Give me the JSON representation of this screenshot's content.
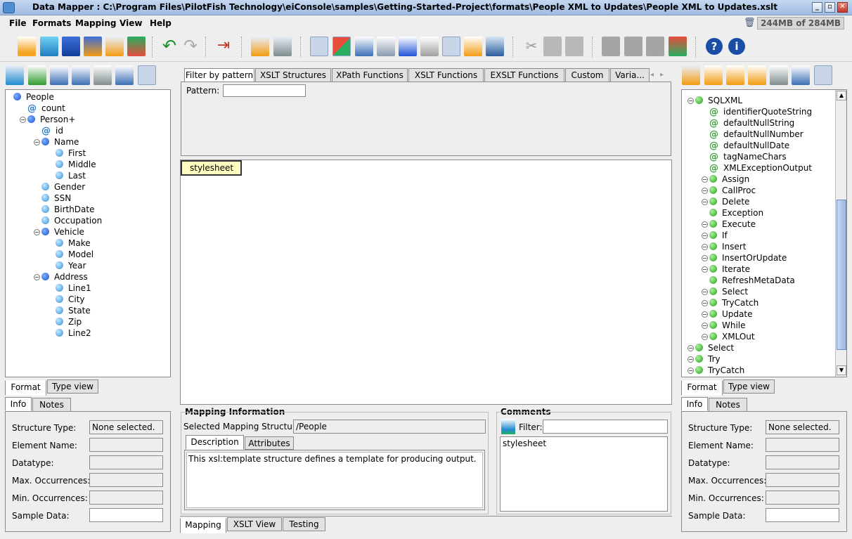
{
  "window": {
    "title": "Data Mapper : C:\\Program Files\\PilotFish Technology\\eiConsole\\samples\\Getting-Started-Project\\formats\\People XML to Updates\\People XML to Updates.xslt"
  },
  "menu": [
    "File",
    "Formats",
    "Mapping",
    "View",
    "Help"
  ],
  "memory": "244MB of 284MB",
  "left_tree": [
    {
      "label": "People",
      "kind": "element",
      "indent": 0,
      "exp": false
    },
    {
      "label": "count",
      "kind": "attr",
      "indent": 1,
      "exp": false
    },
    {
      "label": "Person+",
      "kind": "element",
      "indent": 1,
      "exp": true
    },
    {
      "label": "id",
      "kind": "attr",
      "indent": 2,
      "exp": false
    },
    {
      "label": "Name",
      "kind": "element",
      "indent": 2,
      "exp": true
    },
    {
      "label": "First",
      "kind": "leaf",
      "indent": 3,
      "exp": false
    },
    {
      "label": "Middle",
      "kind": "leaf",
      "indent": 3,
      "exp": false
    },
    {
      "label": "Last",
      "kind": "leaf",
      "indent": 3,
      "exp": false
    },
    {
      "label": "Gender",
      "kind": "leaf",
      "indent": 2,
      "exp": false
    },
    {
      "label": "SSN",
      "kind": "leaf",
      "indent": 2,
      "exp": false
    },
    {
      "label": "BirthDate",
      "kind": "leaf",
      "indent": 2,
      "exp": false
    },
    {
      "label": "Occupation",
      "kind": "leaf",
      "indent": 2,
      "exp": false
    },
    {
      "label": "Vehicle",
      "kind": "element",
      "indent": 2,
      "exp": true
    },
    {
      "label": "Make",
      "kind": "leaf",
      "indent": 3,
      "exp": false
    },
    {
      "label": "Model",
      "kind": "leaf",
      "indent": 3,
      "exp": false
    },
    {
      "label": "Year",
      "kind": "leaf",
      "indent": 3,
      "exp": false
    },
    {
      "label": "Address",
      "kind": "element",
      "indent": 2,
      "exp": true
    },
    {
      "label": "Line1",
      "kind": "leaf",
      "indent": 3,
      "exp": false
    },
    {
      "label": "City",
      "kind": "leaf",
      "indent": 3,
      "exp": false
    },
    {
      "label": "State",
      "kind": "leaf",
      "indent": 3,
      "exp": false
    },
    {
      "label": "Zip",
      "kind": "leaf",
      "indent": 3,
      "exp": false
    },
    {
      "label": "Line2",
      "kind": "leaf",
      "indent": 3,
      "exp": false
    }
  ],
  "left_view_tabs": [
    "Format",
    "Type view"
  ],
  "left_info_tabs": [
    "Info",
    "Notes"
  ],
  "info_labels": [
    "Structure Type:",
    "Element Name:",
    "Datatype:",
    "Max. Occurrences:",
    "Min. Occurrences:",
    "Sample Data:"
  ],
  "left_info_values": [
    "None selected.",
    "",
    "",
    "",
    "",
    ""
  ],
  "center_tabs": [
    "Filter by pattern",
    "XSLT Structures",
    "XPath Functions",
    "XSLT Functions",
    "EXSLT Functions",
    "Custom",
    "Varia..."
  ],
  "pattern_label": "Pattern:",
  "pattern_value": "",
  "mapping_node": "stylesheet",
  "mapping_info": {
    "title": "Mapping Information",
    "selected_label": "Selected Mapping Structure:",
    "selected_value": "/People",
    "tabs": [
      "Description",
      "Attributes"
    ],
    "description": "This xsl:template structure defines a template for producing output."
  },
  "comments": {
    "title": "Comments",
    "filter_label": "Filter:",
    "filter_value": "",
    "text": "stylesheet"
  },
  "bottom_tabs": [
    "Mapping",
    "XSLT View",
    "Testing"
  ],
  "right_tree": [
    {
      "label": "SQLXML",
      "kind": "green",
      "indent": 0,
      "exp": true
    },
    {
      "label": "identifierQuoteString",
      "kind": "attrg",
      "indent": 1,
      "exp": false
    },
    {
      "label": "defaultNullString",
      "kind": "attrg",
      "indent": 1,
      "exp": false
    },
    {
      "label": "defaultNullNumber",
      "kind": "attrg",
      "indent": 1,
      "exp": false
    },
    {
      "label": "defaultNullDate",
      "kind": "attrg",
      "indent": 1,
      "exp": false
    },
    {
      "label": "tagNameChars",
      "kind": "attrg",
      "indent": 1,
      "exp": false
    },
    {
      "label": "XMLExceptionOutput",
      "kind": "attrg",
      "indent": 1,
      "exp": false
    },
    {
      "label": "Assign",
      "kind": "green",
      "indent": 1,
      "exp": true
    },
    {
      "label": "CallProc",
      "kind": "green",
      "indent": 1,
      "exp": true
    },
    {
      "label": "Delete",
      "kind": "green",
      "indent": 1,
      "exp": true
    },
    {
      "label": "Exception",
      "kind": "green",
      "indent": 1,
      "exp": false
    },
    {
      "label": "Execute",
      "kind": "green",
      "indent": 1,
      "exp": true
    },
    {
      "label": "If",
      "kind": "green",
      "indent": 1,
      "exp": true
    },
    {
      "label": "Insert",
      "kind": "green",
      "indent": 1,
      "exp": true
    },
    {
      "label": "InsertOrUpdate",
      "kind": "green",
      "indent": 1,
      "exp": true
    },
    {
      "label": "Iterate",
      "kind": "green",
      "indent": 1,
      "exp": true
    },
    {
      "label": "RefreshMetaData",
      "kind": "green",
      "indent": 1,
      "exp": false
    },
    {
      "label": "Select",
      "kind": "green",
      "indent": 1,
      "exp": true
    },
    {
      "label": "TryCatch",
      "kind": "green",
      "indent": 1,
      "exp": true
    },
    {
      "label": "Update",
      "kind": "green",
      "indent": 1,
      "exp": true
    },
    {
      "label": "While",
      "kind": "green",
      "indent": 1,
      "exp": true
    },
    {
      "label": "XMLOut",
      "kind": "green",
      "indent": 1,
      "exp": true
    },
    {
      "label": "Select",
      "kind": "green",
      "indent": 0,
      "exp": true
    },
    {
      "label": "Try",
      "kind": "green",
      "indent": 0,
      "exp": true
    },
    {
      "label": "TryCatch",
      "kind": "green",
      "indent": 0,
      "exp": true
    }
  ],
  "right_view_tabs": [
    "Format",
    "Type view"
  ],
  "right_info_tabs": [
    "Info",
    "Notes"
  ],
  "right_info_values": [
    "None selected.",
    "",
    "",
    "",
    "",
    ""
  ]
}
